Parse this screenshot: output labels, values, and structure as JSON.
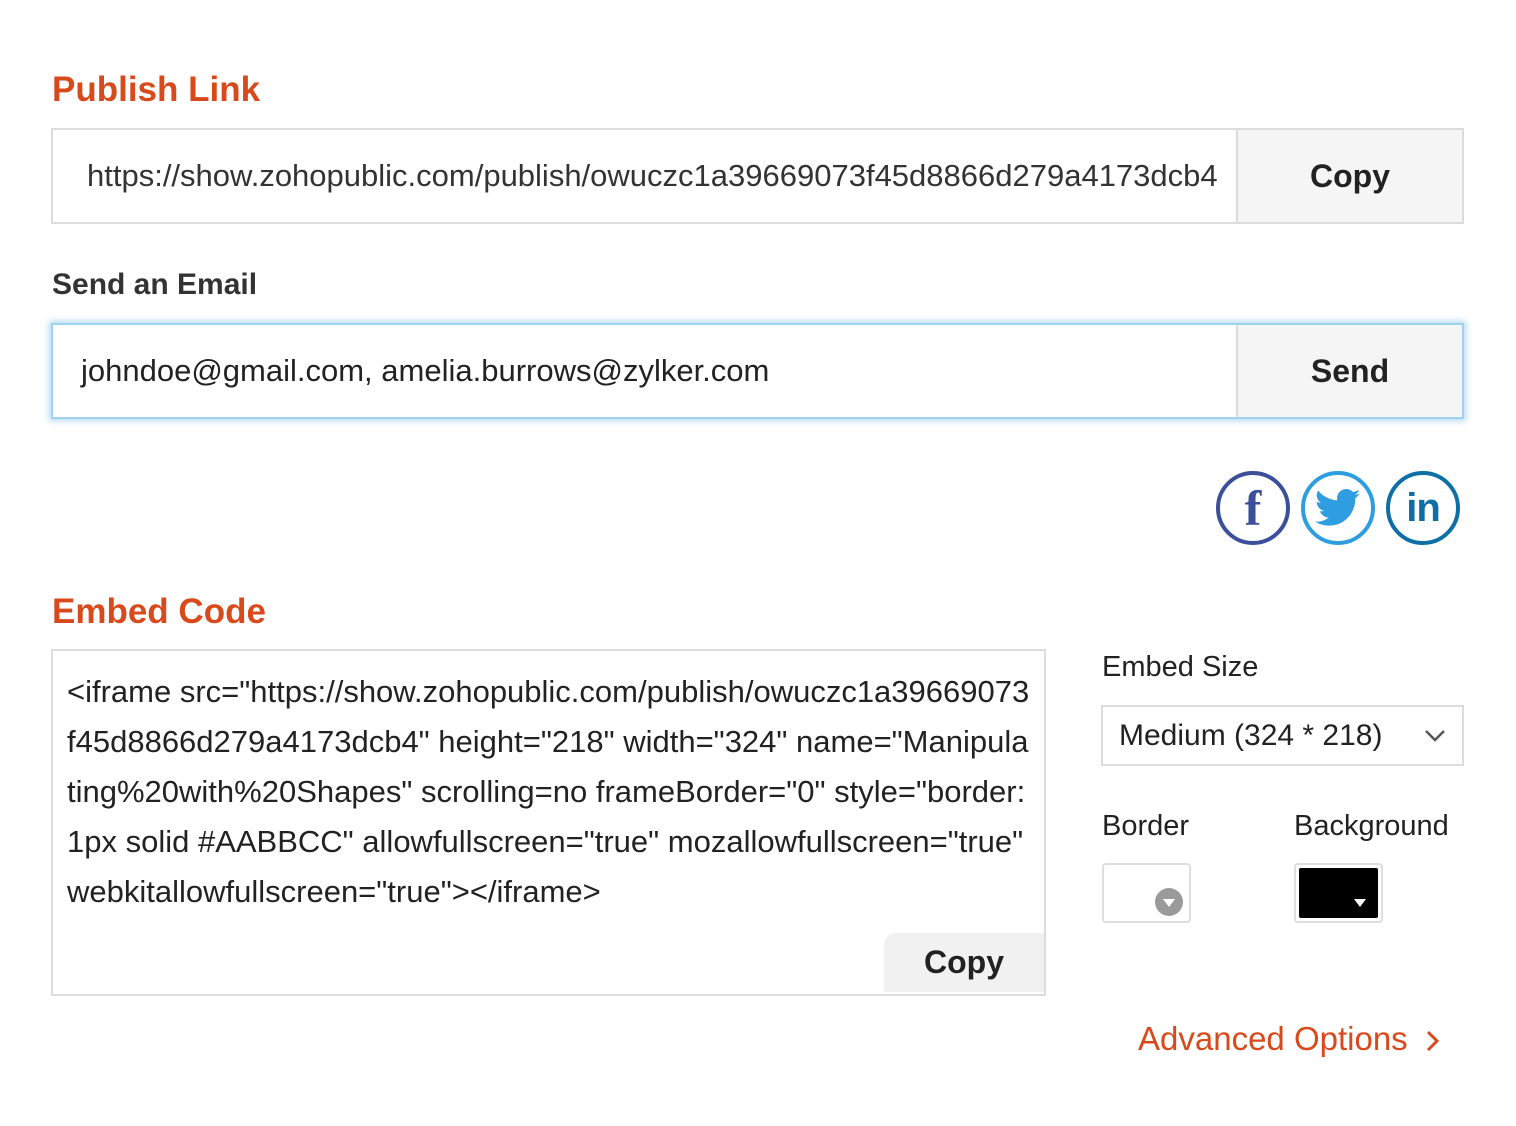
{
  "publish_link": {
    "title": "Publish Link",
    "url": "https://show.zohopublic.com/publish/owuczc1a39669073f45d8866d279a4173dcb4",
    "copy_label": "Copy"
  },
  "email": {
    "title": "Send an Email",
    "value": "johndoe@gmail.com, amelia.burrows@zylker.com",
    "send_label": "Send"
  },
  "social": {
    "facebook": "f",
    "linkedin": "in"
  },
  "embed": {
    "title": "Embed Code",
    "code": "<iframe src=\"https://show.zohopublic.com/publish/owuczc1a39669073f45d8866d279a4173dcb4\" height=\"218\" width=\"324\" name=\"Manipulating%20with%20Shapes\" scrolling=no frameBorder=\"0\" style=\"border:1px solid #AABBCC\" allowfullscreen=\"true\" mozallowfullscreen=\"true\" webkitallowfullscreen=\"true\"></iframe>",
    "copy_label": "Copy",
    "size_label": "Embed Size",
    "size_value": "Medium (324 * 218)",
    "border_label": "Border",
    "background_label": "Background",
    "border_color": "#ffffff",
    "background_color": "#000000"
  },
  "advanced": {
    "label": "Advanced Options"
  },
  "colors": {
    "accent": "#d84a1b",
    "facebook": "#3b4f9a",
    "twitter": "#2f9ee0",
    "linkedin": "#0e6ea6",
    "focus": "#9fd2ee"
  }
}
